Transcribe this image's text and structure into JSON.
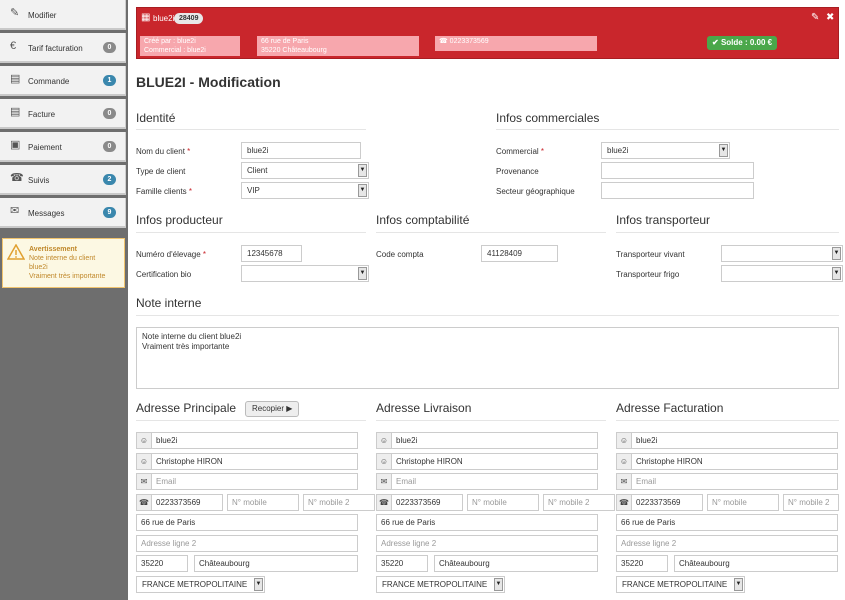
{
  "sidebar": {
    "items": [
      {
        "label": "Modifier",
        "icon": "edit-icon",
        "badge": ""
      },
      {
        "label": "Tarif facturation",
        "icon": "euro-icon",
        "badge": "0"
      },
      {
        "label": "Commande",
        "icon": "document-icon",
        "badge": "1"
      },
      {
        "label": "Facture",
        "icon": "invoice-icon",
        "badge": "0"
      },
      {
        "label": "Paiement",
        "icon": "credit-card-icon",
        "badge": "0"
      },
      {
        "label": "Suivis",
        "icon": "phone-icon",
        "badge": "2"
      },
      {
        "label": "Messages",
        "icon": "envelope-icon",
        "badge": "9"
      }
    ],
    "warning": {
      "title": "Avertissement",
      "line1": "Note interne du client",
      "line2": "blue2i",
      "line3": "Vraiment très importante"
    }
  },
  "header": {
    "client_name": "blue2i",
    "count": "28409",
    "created_by": "Créé par : blue2i",
    "commercial": "Commercial : blue2i",
    "address1": "66 rue de Paris",
    "address2": "35220 Châteaubourg",
    "phone": "0223373569",
    "solde": "Solde : 0.00 €",
    "accent_color": "#c9262c"
  },
  "page_title": "BLUE2I - Modification",
  "identite": {
    "title": "Identité",
    "nom_label": "Nom du client",
    "nom_value": "blue2i",
    "type_label": "Type de client",
    "type_value": "Client",
    "famille_label": "Famille clients",
    "famille_value": "VIP"
  },
  "commerciales": {
    "title": "Infos commerciales",
    "commercial_label": "Commercial",
    "commercial_value": "blue2i",
    "provenance_label": "Provenance",
    "secteur_label": "Secteur géographique"
  },
  "producteur": {
    "title": "Infos producteur",
    "elevage_label": "Numéro d'élevage",
    "elevage_value": "12345678",
    "bio_label": "Certification bio"
  },
  "comptabilite": {
    "title": "Infos comptabilité",
    "code_label": "Code compta",
    "code_value": "41128409"
  },
  "transporteur": {
    "title": "Infos transporteur",
    "vivant_label": "Transporteur vivant",
    "frigo_label": "Transporteur frigo"
  },
  "note": {
    "title": "Note interne",
    "line1": "Note interne du client blue2i",
    "line2": "Vraiment très importante"
  },
  "recopier_label": "Recopier",
  "addresses": [
    {
      "title": "Adresse Principale",
      "name": "blue2i",
      "contact": "Christophe HIRON",
      "email_ph": "Email",
      "phone": "0223373569",
      "mobile_ph": "N° mobile",
      "mobile2_ph": "N° mobile 2",
      "line1": "66 rue de Paris",
      "line2_ph": "Adresse ligne 2",
      "zip": "35220",
      "city": "Châteaubourg",
      "country": "FRANCE METROPOLITAINE"
    },
    {
      "title": "Adresse Livraison",
      "name": "blue2i",
      "contact": "Christophe HIRON",
      "email_ph": "Email",
      "phone": "0223373569",
      "mobile_ph": "N° mobile",
      "mobile2_ph": "N° mobile 2",
      "line1": "66 rue de Paris",
      "line2_ph": "Adresse ligne 2",
      "zip": "35220",
      "city": "Châteaubourg",
      "country": "FRANCE METROPOLITAINE"
    },
    {
      "title": "Adresse Facturation",
      "name": "blue2i",
      "contact": "Christophe HIRON",
      "email_ph": "Email",
      "phone": "0223373569",
      "mobile_ph": "N° mobile",
      "mobile2_ph": "N° mobile 2",
      "line1": "66 rue de Paris",
      "line2_ph": "Adresse ligne 2",
      "zip": "35220",
      "city": "Châteaubourg",
      "country": "FRANCE METROPOLITAINE"
    }
  ]
}
